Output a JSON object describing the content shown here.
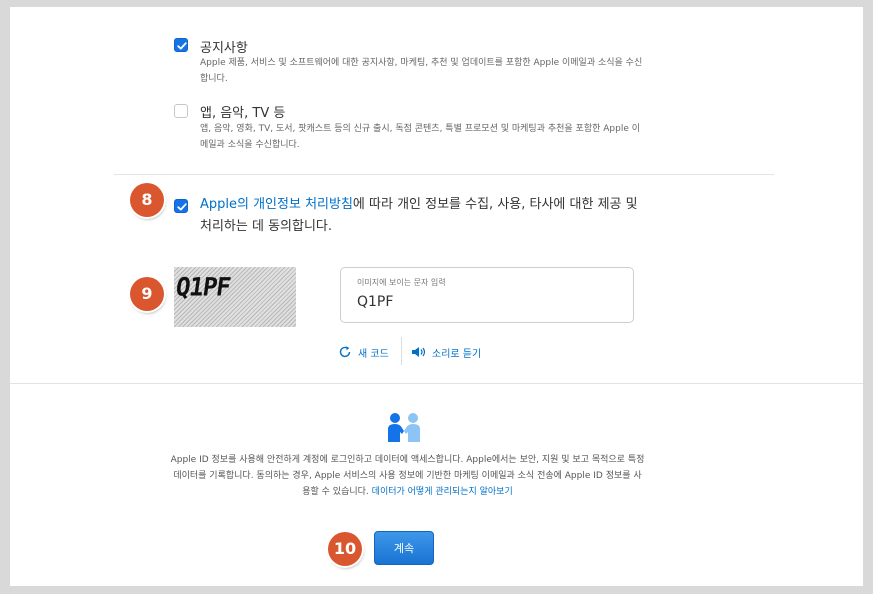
{
  "consent": {
    "announcements": {
      "title": "공지사항",
      "description": "Apple 제품, 서비스 및 소프트웨어에 대한 공지사항, 마케팅, 추천 및 업데이트를 포함한 Apple 이메일과 소식을 수신합니다.",
      "checked": true
    },
    "apps_music_tv": {
      "title": "앱, 음악, TV 등",
      "description": "앱, 음악, 영화, TV, 도서, 팟캐스트 등의 신규 출시, 독점 콘텐츠, 특별 프로모션 및 마케팅과 추천을 포함한 Apple 이메일과 소식을 수신합니다.",
      "checked": false
    },
    "privacy": {
      "link_text": "Apple의 개인정보 처리방침",
      "text": "에 따라 개인 정보를 수집, 사용, 타사에 대한 제공 및 처리하는 데 동의합니다.",
      "checked": true
    }
  },
  "captcha": {
    "image_text": "Q1PF",
    "input_label": "이미지에 보이는 문자 입력",
    "input_value": "Q1PF",
    "new_code_label": "새 코드",
    "audio_label": "소리로 듣기"
  },
  "footer": {
    "text": "Apple ID 정보를 사용해 안전하게 계정에 로그인하고 데이터에 액세스합니다. Apple에서는 보안, 지원 및 보고 목적으로 특정 데이터를 기록합니다. 동의하는 경우, Apple 서비스의 사용 정보에 기반한 마케팅 이메일과 소식 전송에 Apple ID 정보를 사용할 수 있습니다.",
    "link_text": "데이터가 어떻게 관리되는지 알아보기"
  },
  "continue_button": {
    "label": "계속"
  },
  "annotations": {
    "badge_8": "8",
    "badge_9": "9",
    "badge_10": "10"
  },
  "colors": {
    "accent": "#1473e6",
    "link": "#0070c9",
    "badge": "#d9562f"
  },
  "icons": {
    "privacy": "handshake-people-icon",
    "refresh": "refresh-icon",
    "audio": "speaker-icon"
  }
}
